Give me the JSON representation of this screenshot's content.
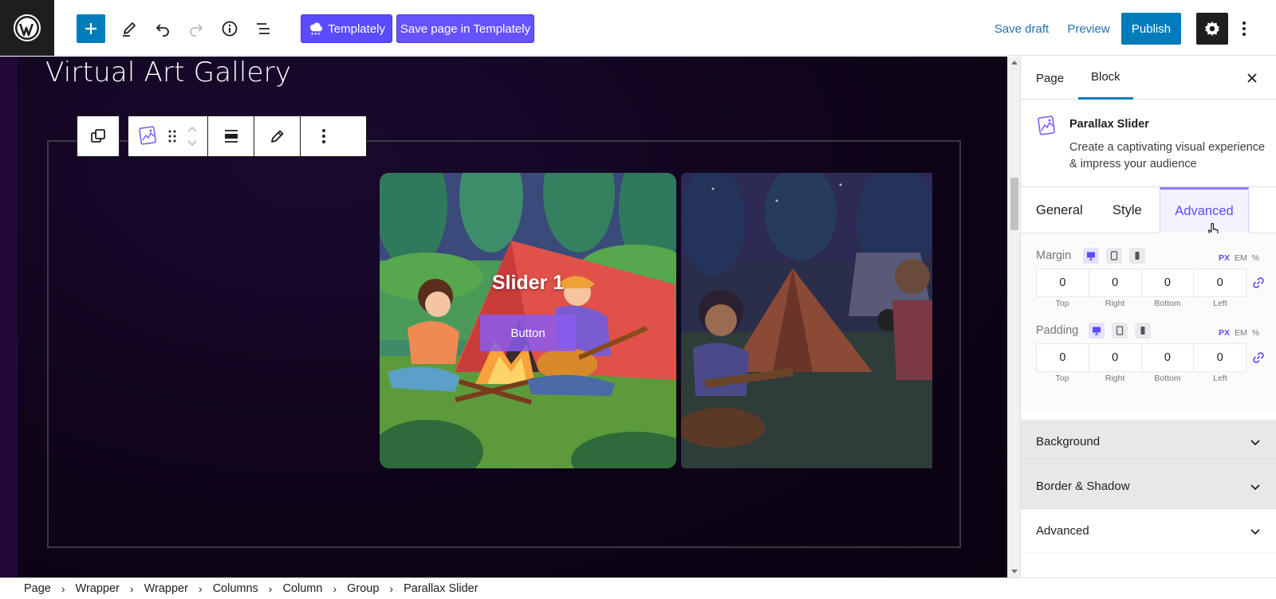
{
  "toolbar": {
    "templately_label": "Templately",
    "save_templately_label": "Save page in Templately",
    "save_draft_label": "Save draft",
    "preview_label": "Preview",
    "publish_label": "Publish"
  },
  "canvas": {
    "page_title": "Virtual Art Gallery",
    "slides": [
      {
        "title": "Slider 1",
        "button_label": "Button"
      }
    ]
  },
  "sidebar": {
    "tabs": [
      "Page",
      "Block"
    ],
    "active_tab": "Block",
    "block": {
      "name": "Parallax Slider",
      "description": "Create a captivating visual experience & impress your audience"
    },
    "control_tabs": [
      "General",
      "Style",
      "Advanced"
    ],
    "active_control_tab": "Advanced",
    "margin": {
      "label": "Margin",
      "values": [
        "0",
        "0",
        "0",
        "0"
      ],
      "sides": [
        "Top",
        "Right",
        "Bottom",
        "Left"
      ],
      "units": [
        "PX",
        "EM",
        "%"
      ],
      "active_unit": "PX"
    },
    "padding": {
      "label": "Padding",
      "values": [
        "0",
        "0",
        "0",
        "0"
      ],
      "sides": [
        "Top",
        "Right",
        "Bottom",
        "Left"
      ],
      "units": [
        "PX",
        "EM",
        "%"
      ],
      "active_unit": "PX"
    },
    "panels": [
      "Background",
      "Border & Shadow",
      "Advanced"
    ]
  },
  "breadcrumb": [
    "Page",
    "Wrapper",
    "Wrapper",
    "Columns",
    "Column",
    "Group",
    "Parallax Slider"
  ],
  "colors": {
    "wp_blue": "#007cba",
    "templately_purple": "#5b4bff",
    "canvas_bg": "#0e0418",
    "accent_purple": "#5b4bff"
  }
}
